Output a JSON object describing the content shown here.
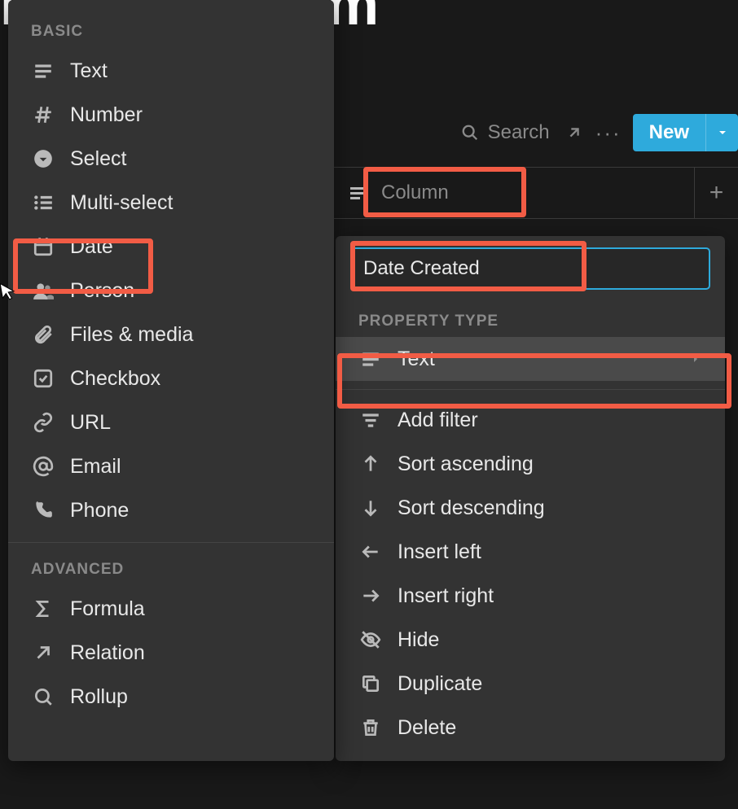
{
  "page": {
    "title": "Notes System"
  },
  "toolbar": {
    "search_label": "Search",
    "new_label": "New"
  },
  "column_header": {
    "label": "Column"
  },
  "config": {
    "name_value": "Date Created",
    "section_label": "PROPERTY TYPE",
    "type_label": "Text",
    "actions": {
      "add_filter": "Add filter",
      "sort_asc": "Sort ascending",
      "sort_desc": "Sort descending",
      "insert_left": "Insert left",
      "insert_right": "Insert right",
      "hide": "Hide",
      "duplicate": "Duplicate",
      "delete": "Delete"
    }
  },
  "types": {
    "basic_label": "BASIC",
    "advanced_label": "ADVANCED",
    "basic": {
      "text": "Text",
      "number": "Number",
      "select": "Select",
      "multi_select": "Multi-select",
      "date": "Date",
      "person": "Person",
      "files": "Files & media",
      "checkbox": "Checkbox",
      "url": "URL",
      "email": "Email",
      "phone": "Phone"
    },
    "advanced": {
      "formula": "Formula",
      "relation": "Relation",
      "rollup": "Rollup"
    }
  }
}
